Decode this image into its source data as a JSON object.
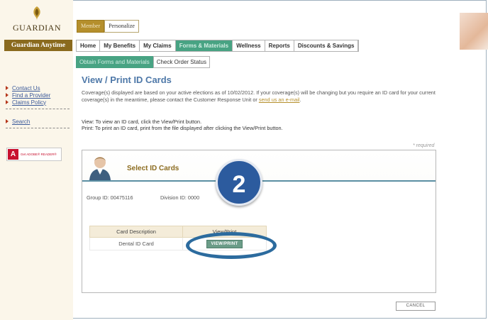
{
  "brand": {
    "logo_text": "GUARDIAN",
    "tagline": "Guardian Anytime"
  },
  "top_tabs": [
    {
      "label": "Member",
      "active": true
    },
    {
      "label": "Personalize",
      "active": false
    }
  ],
  "main_nav": [
    {
      "label": "Home",
      "active": false
    },
    {
      "label": "My Benefits",
      "active": false
    },
    {
      "label": "My Claims",
      "active": false
    },
    {
      "label": "Forms & Materials",
      "active": true
    },
    {
      "label": "Wellness",
      "active": false
    },
    {
      "label": "Reports",
      "active": false
    },
    {
      "label": "Discounts & Savings",
      "active": false
    }
  ],
  "sub_nav": [
    {
      "label": "Obtain Forms and Materials",
      "active": true
    },
    {
      "label": "Check Order Status",
      "active": false
    }
  ],
  "sidebar": {
    "links_group1": [
      "Contact Us",
      "Find a Provider",
      "Claims Policy"
    ],
    "links_group2": [
      "Search"
    ],
    "adobe_text": "Get ADOBE® READER®"
  },
  "page": {
    "title": "View / Print ID Cards",
    "intro_text": "Coverage(s) displayed are based on your active elections as of 10/02/2012. If your coverage(s) will be changing but you require an ID card for your current coverage(s) in the meantime, please contact the Customer Response Unit or",
    "intro_link": "send us an e-mail",
    "intro_end": ".",
    "instruction_view": "View: To view an ID card, click the View/Print button.",
    "instruction_print": "Print: To print an ID card, print from the file displayed after clicking the View/Print button.",
    "required_note": "* required"
  },
  "panel": {
    "title": "Select ID Cards",
    "group_id": "Group ID: 00475116",
    "division_id": "Division ID: 0000",
    "table_headers": [
      "Card Description",
      "View/Print"
    ],
    "rows": [
      {
        "description": "Dental ID Card",
        "button": "VIEW/PRINT"
      }
    ]
  },
  "cancel_label": "CANCEL",
  "callout": {
    "number": "2"
  },
  "colors": {
    "accent_green": "#48a383",
    "gold": "#b58f2c",
    "title_blue": "#4e78a8",
    "callout_blue": "#2c5b9e"
  }
}
